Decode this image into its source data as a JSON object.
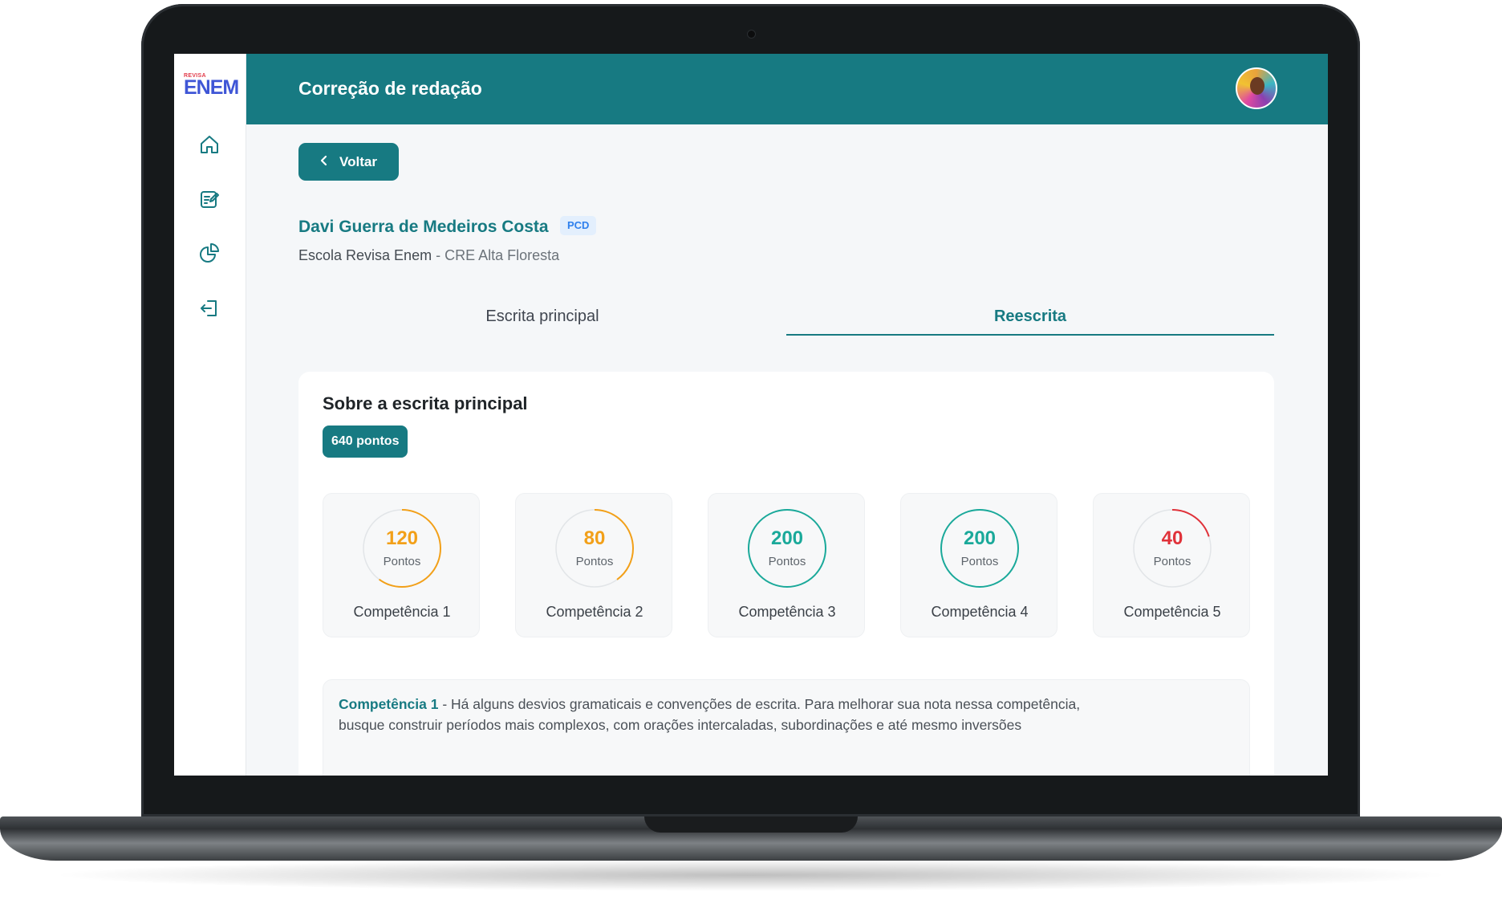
{
  "logo": {
    "small": "REVISA",
    "big": "ENEM"
  },
  "sidebar": {
    "items": [
      {
        "icon": "home-icon"
      },
      {
        "icon": "edit-note-icon"
      },
      {
        "icon": "pie-chart-icon"
      },
      {
        "icon": "logout-icon"
      }
    ]
  },
  "header": {
    "title": "Correção de redação"
  },
  "back_button": {
    "label": "Voltar"
  },
  "student": {
    "name": "Davi Guerra de Medeiros Costa",
    "badge": "PCD",
    "school": "Escola Revisa Enem",
    "separator": " - ",
    "region": "CRE Alta Floresta"
  },
  "tabs": [
    {
      "label": "Escrita principal",
      "active": false
    },
    {
      "label": "Reescrita",
      "active": true
    }
  ],
  "summary": {
    "title": "Sobre a escrita principal",
    "total": "640 pontos"
  },
  "competencies": [
    {
      "value": "120",
      "unit": "Pontos",
      "label": "Competência 1",
      "color": "#f2a019",
      "fraction": 0.6
    },
    {
      "value": "80",
      "unit": "Pontos",
      "label": "Competência 2",
      "color": "#f2a019",
      "fraction": 0.4
    },
    {
      "value": "200",
      "unit": "Pontos",
      "label": "Competência 3",
      "color": "#1aa99a",
      "fraction": 1.0
    },
    {
      "value": "200",
      "unit": "Pontos",
      "label": "Competência 4",
      "color": "#1aa99a",
      "fraction": 1.0
    },
    {
      "value": "40",
      "unit": "Pontos",
      "label": "Competência 5",
      "color": "#e0323a",
      "fraction": 0.2
    }
  ],
  "feedback": [
    {
      "heading": "Competência 1",
      "line1": " - Há alguns desvios gramaticais e convenções de escrita. Para melhorar sua nota nessa competência,",
      "line2": "busque construir períodos mais complexos, com orações intercaladas, subordinações e até mesmo inversões"
    }
  ],
  "colors": {
    "accent": "#177a82",
    "pcd_bg": "#e3effd",
    "pcd_text": "#2f80ed"
  }
}
